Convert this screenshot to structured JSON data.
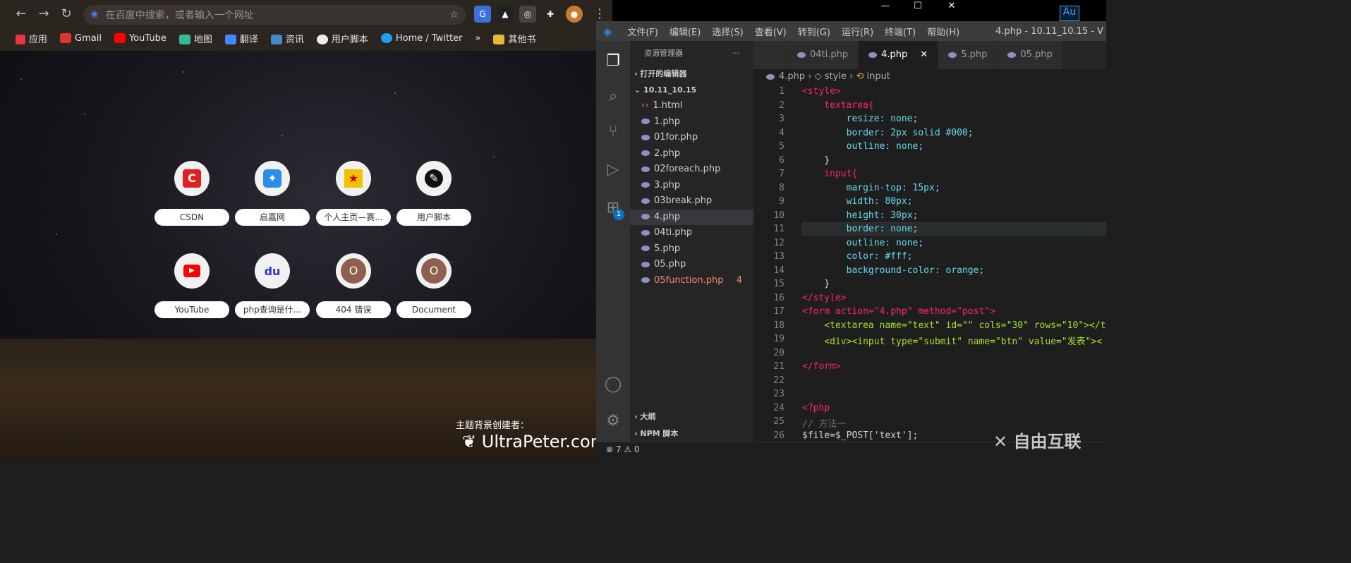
{
  "browser": {
    "omnibox_placeholder": "在百度中搜索，或者输入一个网址",
    "bookmarks": [
      "应用",
      "Gmail",
      "YouTube",
      "地图",
      "翻译",
      "资讯",
      "用户脚本",
      "Home / Twitter",
      "»",
      "其他书"
    ],
    "tiles": [
      {
        "label": "CSDN",
        "icon": "C"
      },
      {
        "label": "启嘉网",
        "icon": "✦"
      },
      {
        "label": "个人主页—赛...",
        "icon": "★"
      },
      {
        "label": "用户脚本",
        "icon": "✎"
      },
      {
        "label": "YouTube",
        "icon": "▶"
      },
      {
        "label": "php查询是什...",
        "icon": "du"
      },
      {
        "label": "404 错误",
        "icon": "O"
      },
      {
        "label": "Document",
        "icon": "O"
      }
    ],
    "credit_label": "主题背景创建者：",
    "credit_name": "UltraPeter.com"
  },
  "vscode": {
    "menu": [
      "文件(F)",
      "编辑(E)",
      "选择(S)",
      "查看(V)",
      "转到(G)",
      "运行(R)",
      "终端(T)",
      "帮助(H)"
    ],
    "window_title": "4.php - 10.11_10.15 - V",
    "explorer_title": "资源管理器",
    "explorer_more": "···",
    "open_editors": "打开的编辑器",
    "folder": "10.11_10.15",
    "files": [
      "1.html",
      "1.php",
      "01for.php",
      "2.php",
      "02foreach.php",
      "3.php",
      "03break.php",
      "4.php",
      "04ti.php",
      "5.php",
      "05.php",
      "05function.php"
    ],
    "problem_count": "4",
    "outline": "大纲",
    "npm": "NPM 脚本",
    "tabs": [
      "04ti.php",
      "4.php",
      "5.php",
      "05.php"
    ],
    "breadcrumb": [
      "4.php",
      "style",
      "input"
    ],
    "status": "⊗ 7 ⚠ 0",
    "badge": "1"
  },
  "watermark": "自由互联",
  "code": [
    {
      "n": "1",
      "t": "<style>"
    },
    {
      "n": "2",
      "t": "    textarea{"
    },
    {
      "n": "3",
      "t": "        resize: none;"
    },
    {
      "n": "4",
      "t": "        border: 2px solid #000;"
    },
    {
      "n": "5",
      "t": "        outline: none;"
    },
    {
      "n": "6",
      "t": "    }"
    },
    {
      "n": "7",
      "t": "    input{"
    },
    {
      "n": "8",
      "t": "        margin-top: 15px;"
    },
    {
      "n": "9",
      "t": "        width: 80px;"
    },
    {
      "n": "10",
      "t": "        height: 30px;"
    },
    {
      "n": "11",
      "t": "        border: none;"
    },
    {
      "n": "12",
      "t": "        outline: none;"
    },
    {
      "n": "13",
      "t": "        color: #fff;"
    },
    {
      "n": "14",
      "t": "        background-color: orange;"
    },
    {
      "n": "15",
      "t": "    }"
    },
    {
      "n": "16",
      "t": "</style>"
    },
    {
      "n": "17",
      "t": "<form action=\"4.php\" method=\"post\">"
    },
    {
      "n": "18",
      "t": "    <textarea name=\"text\" id=\"\" cols=\"30\" rows=\"10\"></t"
    },
    {
      "n": "19",
      "t": "    <div><input type=\"submit\" name=\"btn\" value=\"发表\"><"
    },
    {
      "n": "20",
      "t": ""
    },
    {
      "n": "21",
      "t": "</form>"
    },
    {
      "n": "22",
      "t": ""
    },
    {
      "n": "23",
      "t": ""
    },
    {
      "n": "24",
      "t": "<?php"
    },
    {
      "n": "25",
      "t": "// 方法一"
    },
    {
      "n": "26",
      "t": "$file=$_POST['text'];"
    }
  ]
}
